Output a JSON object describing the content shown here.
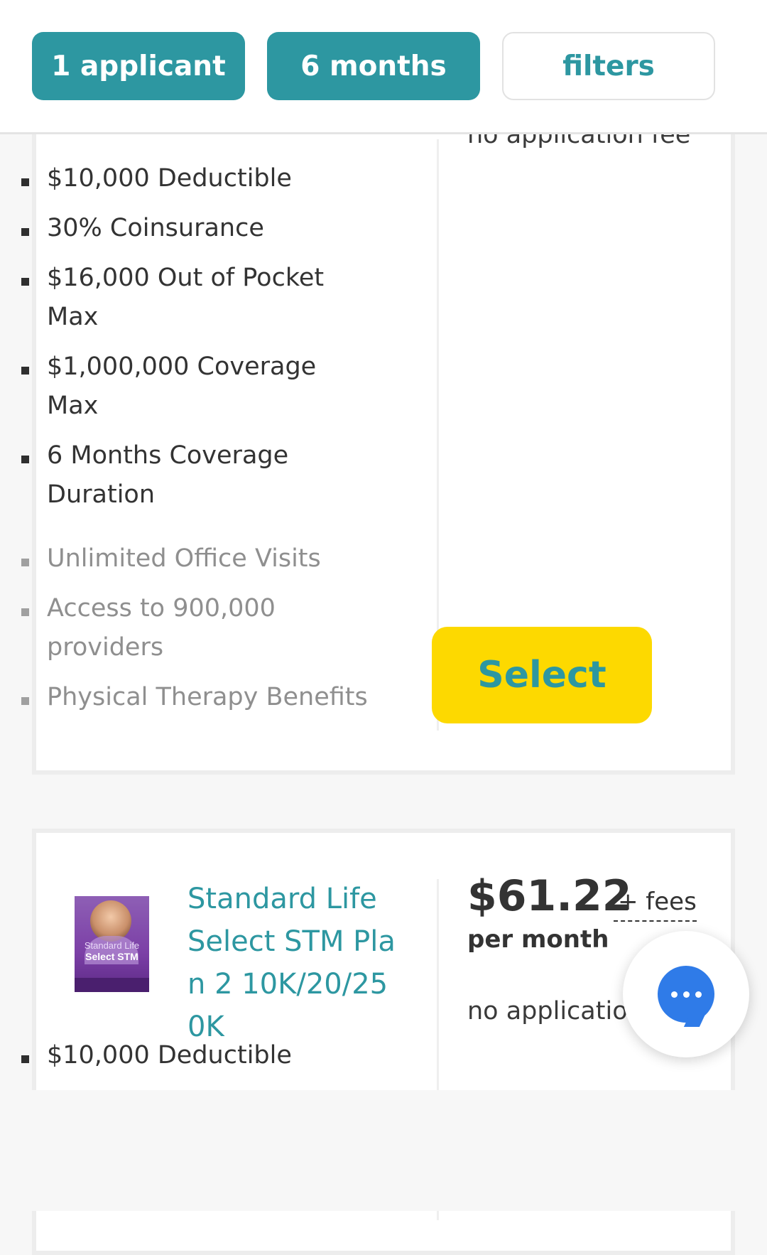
{
  "filters": {
    "applicants": "1 applicant",
    "duration": "6 months",
    "filters": "filters"
  },
  "plan1": {
    "fee_note": "no application fee",
    "features": [
      "$10,000 Deductible",
      "30% Coinsurance",
      "$16,000 Out of Pocket Max",
      "$1,000,000 Coverage Max",
      "6 Months Coverage Duration"
    ],
    "extras": [
      "Unlimited Office Visits",
      "Access to 900,000 providers",
      "Physical Therapy Benefits"
    ],
    "select_label": "Select"
  },
  "plan2": {
    "name": "Standard Life Select STM Plan 2 10K/20/250K",
    "thumb_brand": "Standard Life",
    "thumb_product": "Select STM",
    "price": "$61.22",
    "fees_label": "+ fees",
    "per_month": "per month",
    "fee_note": "no application",
    "features": [
      "$10,000 Deductible"
    ]
  },
  "colors": {
    "teal": "#2d97a1",
    "select_yellow": "#fdd900",
    "chat_blue": "#2f7be8"
  },
  "icons": {
    "chat": "chat-bubble-icon"
  }
}
